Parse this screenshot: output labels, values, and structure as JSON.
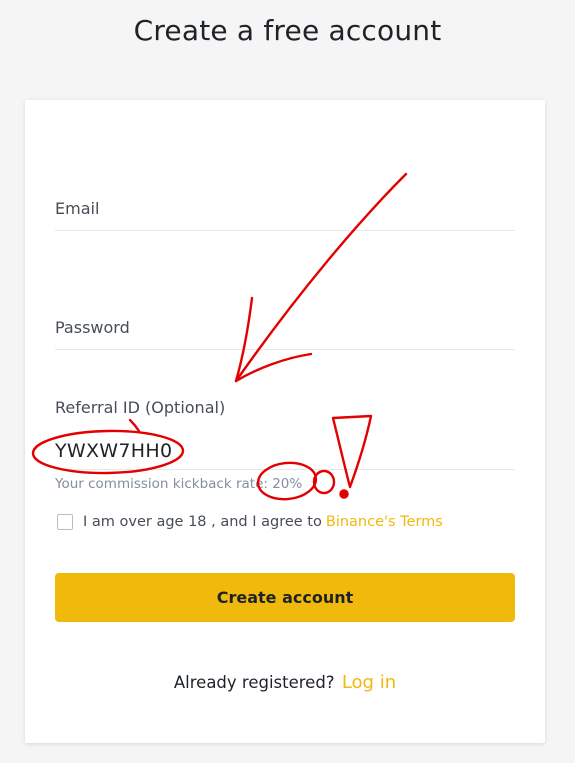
{
  "page": {
    "title": "Create a free account"
  },
  "form": {
    "email_label": "Email",
    "password_label": "Password",
    "referral_label": "Referral ID (Optional)",
    "referral_value": "YWXW7HH0",
    "kickback_hint": "Your commission kickback rate: 20%",
    "agree_text": "I am over age 18 , and I agree to",
    "terms_link": "Binance's Terms",
    "terms_checked": false,
    "submit_label": "Create account"
  },
  "footer": {
    "already_text": "Already registered?",
    "login_link": "Log in"
  },
  "theme": {
    "accent": "#f0b90b",
    "annotation": "#e30000"
  }
}
